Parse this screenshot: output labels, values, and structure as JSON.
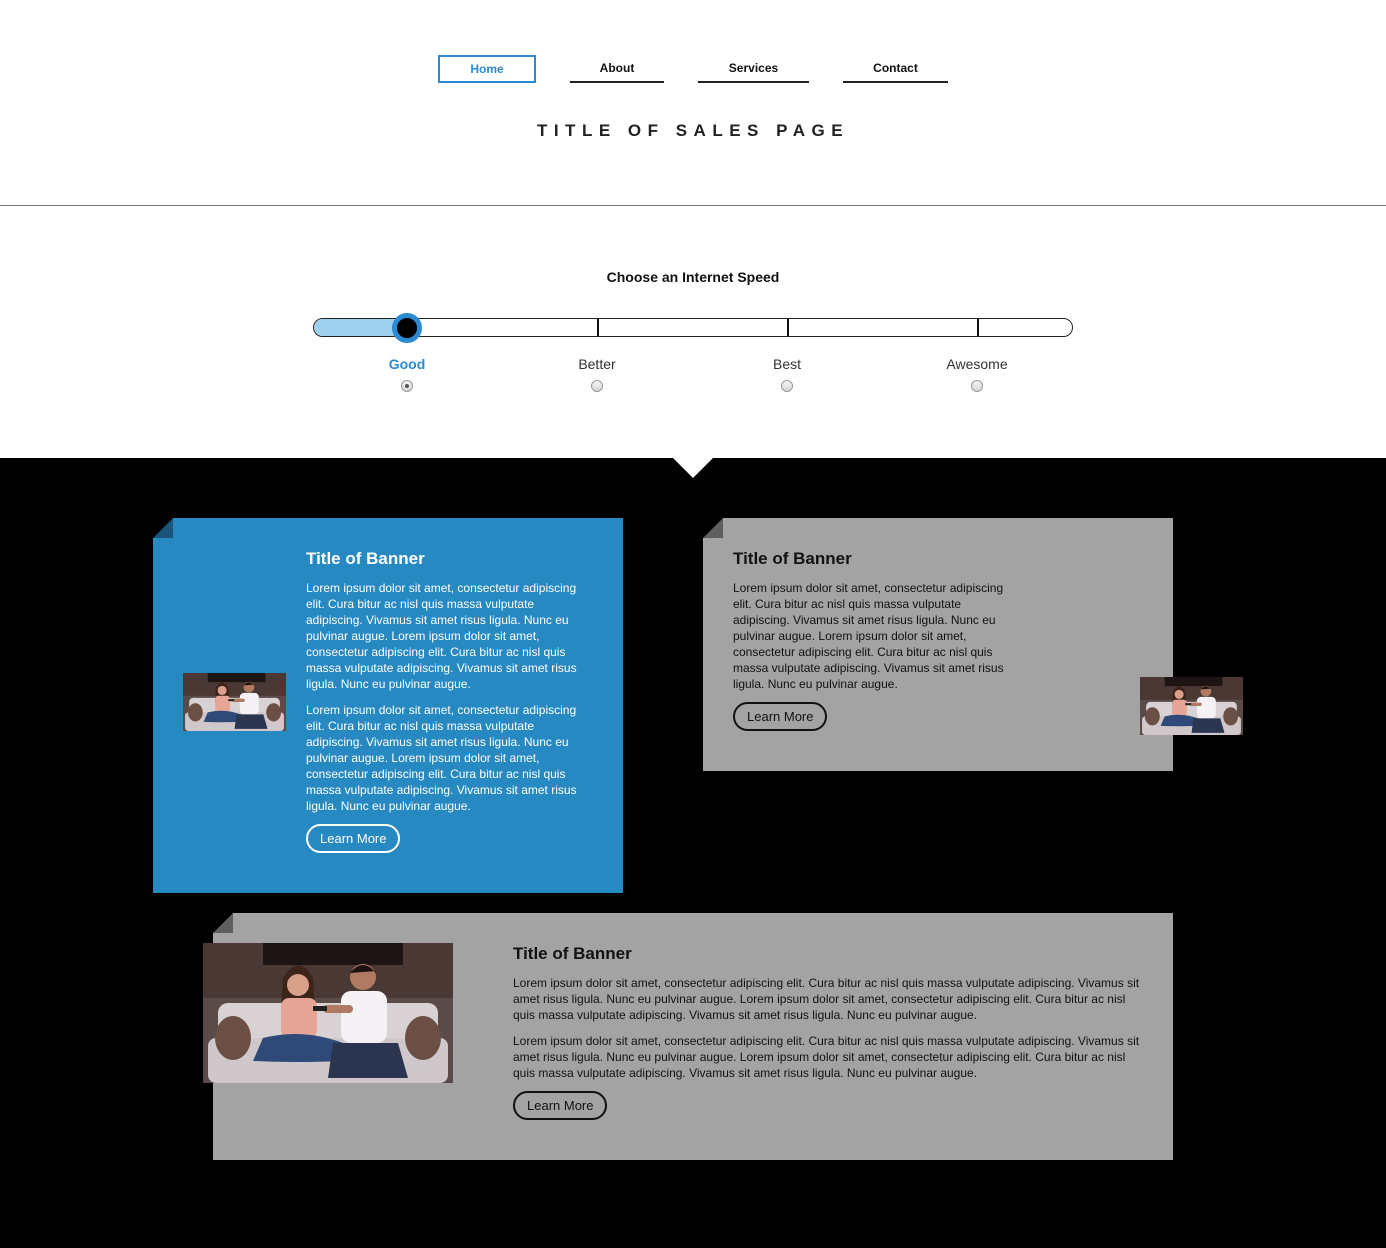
{
  "nav": {
    "items": [
      {
        "label": "Home"
      },
      {
        "label": "About"
      },
      {
        "label": "Services"
      },
      {
        "label": "Contact"
      }
    ],
    "active": "Home"
  },
  "page_title": "TITLE OF SALES PAGE",
  "speed": {
    "heading": "Choose an Internet Speed",
    "options": [
      {
        "label": "Good",
        "selected": true
      },
      {
        "label": "Better",
        "selected": false
      },
      {
        "label": "Best",
        "selected": false
      },
      {
        "label": "Awesome",
        "selected": false
      }
    ],
    "selected_index": 0
  },
  "banners": [
    {
      "style": "blue",
      "title": "Title of Banner",
      "paragraphs": [
        "Lorem ipsum dolor sit amet, consectetur adipiscing elit. Cura bitur ac nisl quis massa vulputate adipiscing. Vivamus sit amet risus ligula. Nunc eu pulvinar augue. Lorem ipsum dolor sit amet, consectetur adipiscing elit. Cura bitur ac nisl quis massa vulputate adipiscing. Vivamus sit amet risus ligula. Nunc eu pulvinar augue.",
        "Lorem ipsum dolor sit amet, consectetur adipiscing elit. Cura bitur ac nisl quis massa vulputate adipiscing. Vivamus sit amet risus ligula. Nunc eu pulvinar augue. Lorem ipsum dolor sit amet, consectetur adipiscing elit. Cura bitur ac nisl quis massa vulputate adipiscing. Vivamus sit amet risus ligula. Nunc eu pulvinar augue."
      ],
      "button": "Learn More"
    },
    {
      "style": "grey",
      "title": "Title of Banner",
      "paragraphs": [
        "Lorem ipsum dolor sit amet, consectetur adipiscing elit. Cura bitur ac nisl quis massa vulputate adipiscing. Vivamus sit amet risus ligula. Nunc eu pulvinar augue. Lorem ipsum dolor sit amet, consectetur adipiscing elit. Cura bitur ac nisl quis massa vulputate adipiscing. Vivamus sit amet risus ligula. Nunc eu pulvinar augue."
      ],
      "button": "Learn More"
    },
    {
      "style": "grey",
      "title": "Title of Banner",
      "paragraphs": [
        "Lorem ipsum dolor sit amet, consectetur adipiscing elit. Cura bitur ac nisl quis massa vulputate adipiscing. Vivamus sit amet risus ligula. Nunc eu pulvinar augue. Lorem ipsum dolor sit amet, consectetur adipiscing elit. Cura bitur ac nisl quis massa vulputate adipiscing. Vivamus sit amet risus ligula. Nunc eu pulvinar augue.",
        "Lorem ipsum dolor sit amet, consectetur adipiscing elit. Cura bitur ac nisl quis massa vulputate adipiscing. Vivamus sit amet risus ligula. Nunc eu pulvinar augue. Lorem ipsum dolor sit amet, consectetur adipiscing elit. Cura bitur ac nisl quis massa vulputate adipiscing. Vivamus sit amet risus ligula. Nunc eu pulvinar augue."
      ],
      "button": "Learn More"
    }
  ],
  "colors": {
    "accent": "#2a8ad3",
    "banner_blue": "#2789c2",
    "banner_grey": "#a3a3a3",
    "track_fill": "#9fd0ee",
    "dark_background": "#000000"
  },
  "icons": {
    "banner_image": "couple-on-couch-photo",
    "slider_thumb": "slider-handle"
  }
}
